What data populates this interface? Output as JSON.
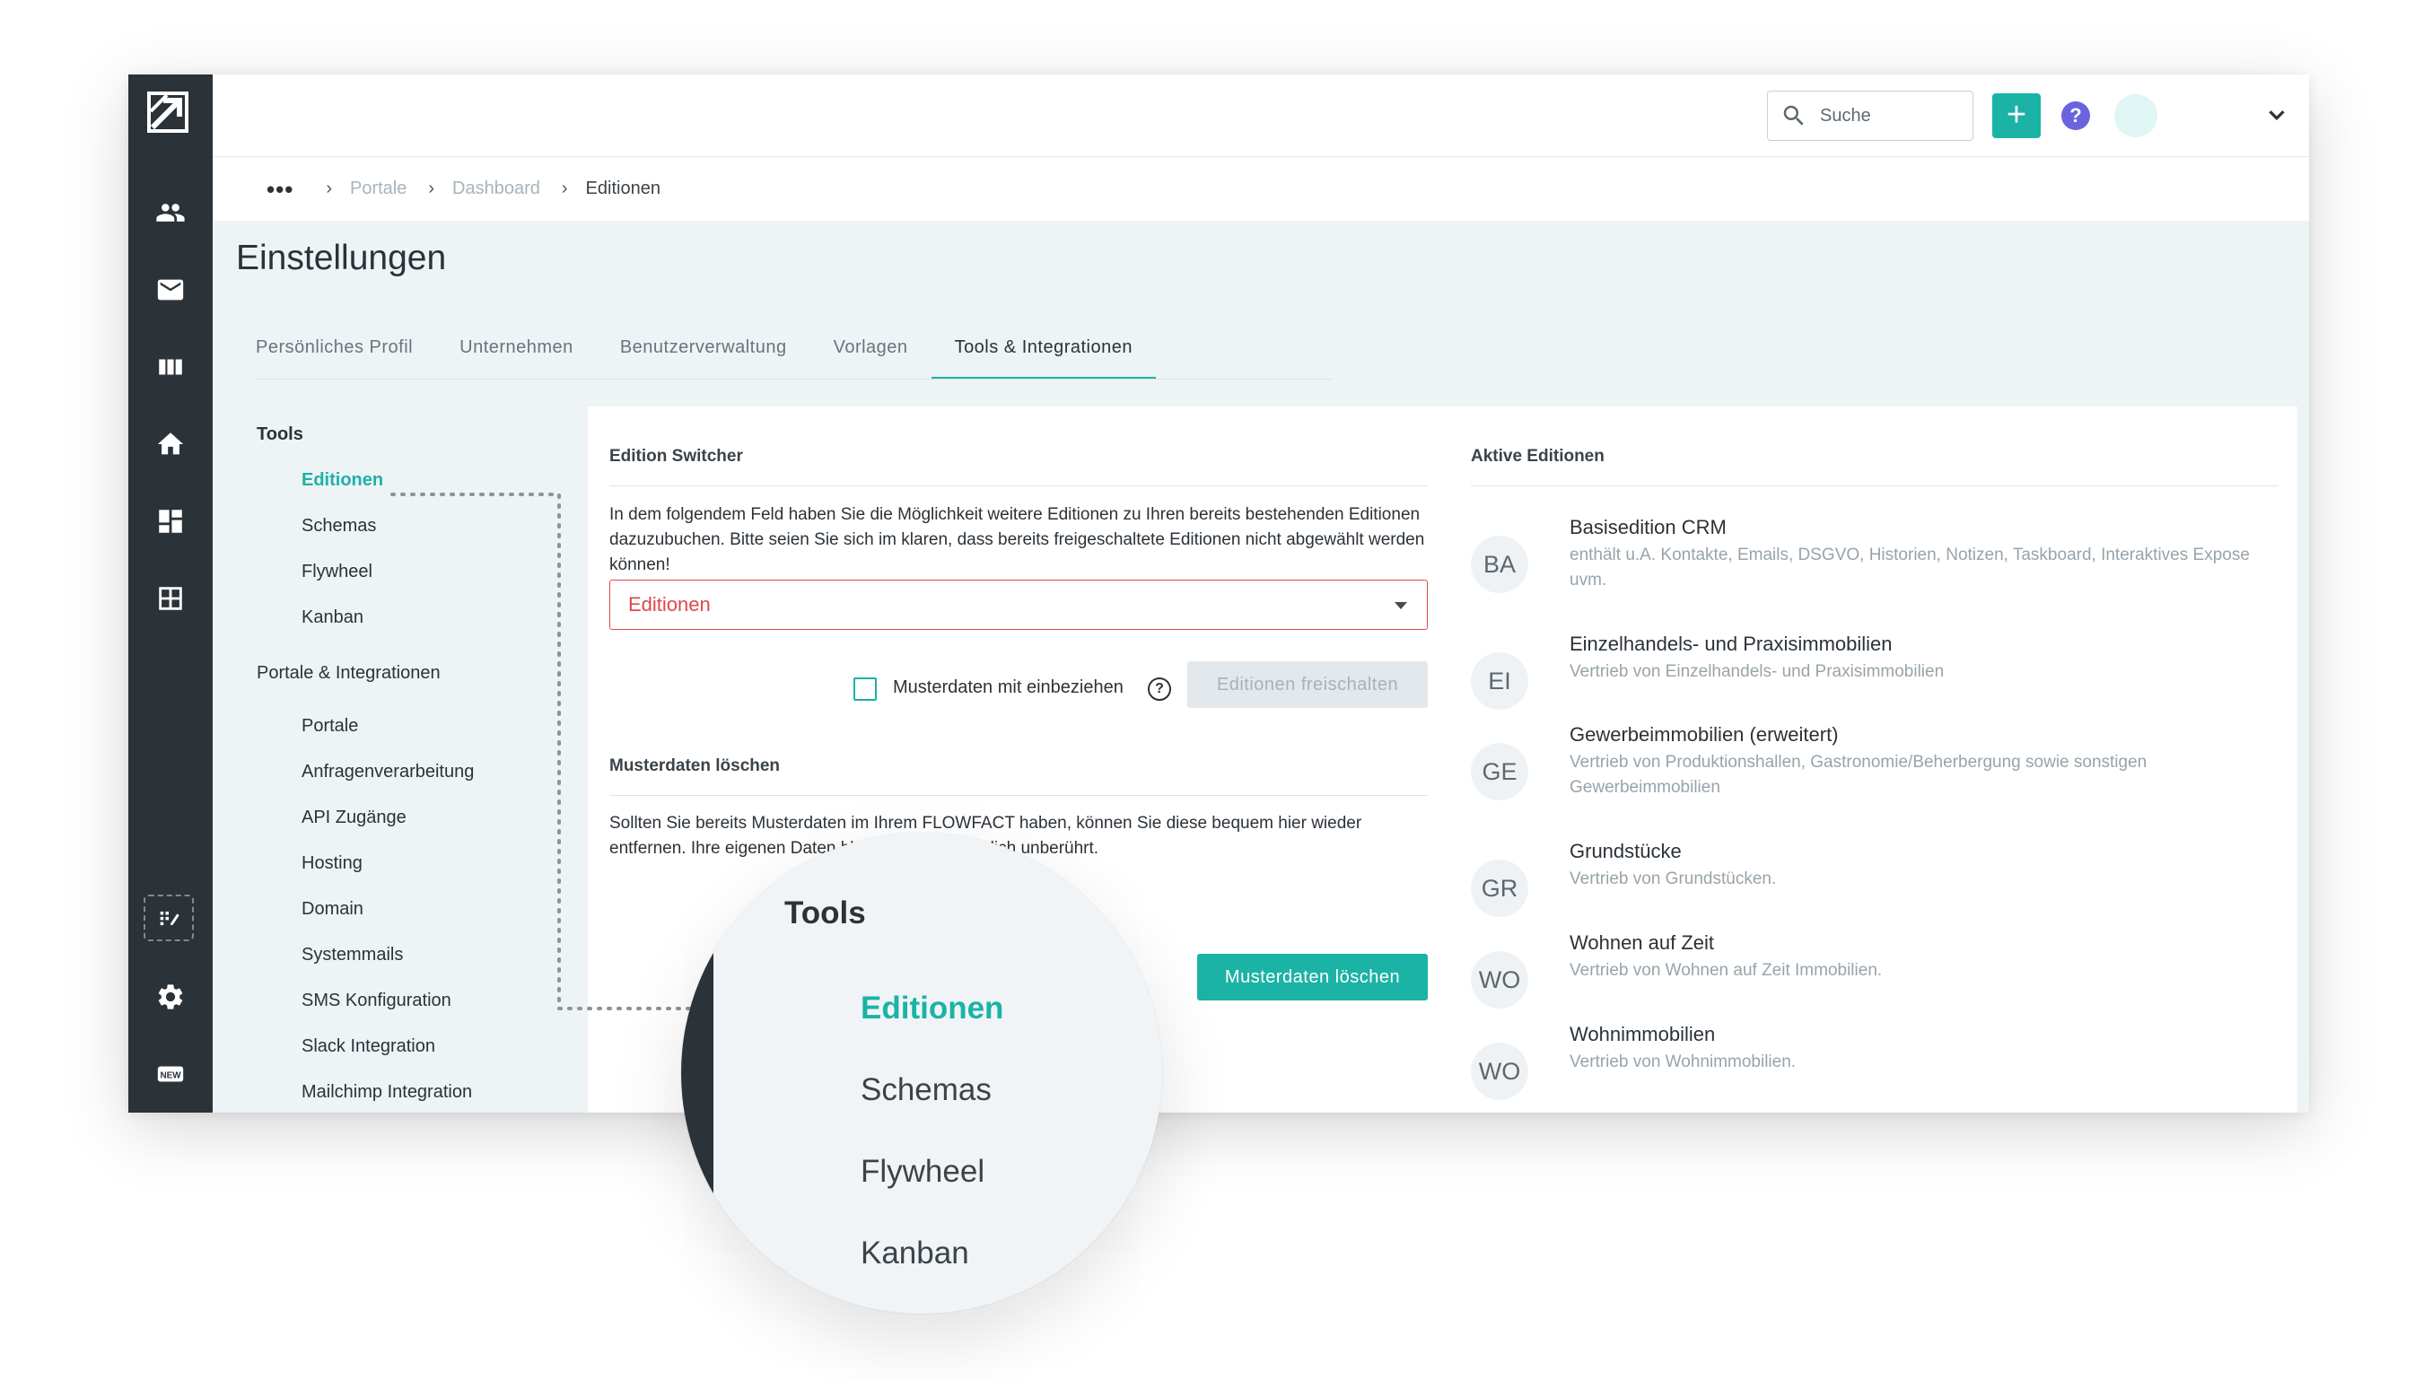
{
  "topbar": {
    "search_placeholder": "Suche",
    "add_label": "+",
    "help_label": "?"
  },
  "breadcrumb": {
    "overflow": "•••",
    "items": [
      "Portale",
      "Dashboard",
      "Editionen"
    ]
  },
  "page": {
    "title": "Einstellungen",
    "tabs": [
      "Persönliches Profil",
      "Unternehmen",
      "Benutzerverwaltung",
      "Vorlagen",
      "Tools & Integrationen"
    ],
    "active_tab": "Tools & Integrationen"
  },
  "tools_menu": {
    "tools_heading": "Tools",
    "tools_items": [
      "Editionen",
      "Schemas",
      "Flywheel",
      "Kanban"
    ],
    "portals_heading": "Portale & Integrationen",
    "portals_items": [
      "Portale",
      "Anfragenverarbeitung",
      "API Zugänge",
      "Hosting",
      "Domain",
      "Systemmails",
      "SMS Konfiguration",
      "Slack Integration",
      "Mailchimp Integration"
    ]
  },
  "edition_switcher": {
    "title": "Edition Switcher",
    "description": "In dem folgendem Feld haben Sie die Möglichkeit weitere Editionen zu Ihren bereits bestehenden Editionen dazuzubuchen. Bitte seien Sie sich im klaren, dass bereits freigeschaltete Editionen nicht abgewählt werden können!",
    "select_placeholder": "Editionen",
    "checkbox_label": "Musterdaten mit einbeziehen",
    "unlock_button": "Editionen freischalten"
  },
  "sample_data": {
    "title": "Musterdaten löschen",
    "description": "Sollten Sie bereits Musterdaten im Ihrem FLOWFACT haben, können Sie diese bequem hier wieder entfernen. Ihre eigenen Daten bleiben davon natürlich unberührt.",
    "delete_button": "Musterdaten löschen"
  },
  "active_editions": {
    "title": "Aktive Editionen",
    "items": [
      {
        "badge": "BA",
        "name": "Basisedition CRM",
        "description": "enthält u.A. Kontakte, Emails, DSGVO, Historien, Notizen, Taskboard, Interaktives Expose uvm."
      },
      {
        "badge": "EI",
        "name": "Einzelhandels- und Praxisimmobilien",
        "description": "Vertrieb von Einzelhandels- und Praxisimmobilien"
      },
      {
        "badge": "GE",
        "name": "Gewerbeimmobilien (erweitert)",
        "description": "Vertrieb von Produktionshallen, Gastronomie/Beherbergung sowie sonstigen Gewerbeimmobilien"
      },
      {
        "badge": "GR",
        "name": "Grundstücke",
        "description": "Vertrieb von Grundstücken."
      },
      {
        "badge": "WO",
        "name": "Wohnen auf Zeit",
        "description": "Vertrieb von Wohnen auf Zeit Immobilien."
      },
      {
        "badge": "WO",
        "name": "Wohnimmobilien",
        "description": "Vertrieb von Wohnimmobilien."
      }
    ]
  },
  "magnifier": {
    "title": "Tools",
    "items": [
      "Editionen",
      "Schemas",
      "Flywheel",
      "Kanban"
    ]
  },
  "icons": {
    "sidebar": [
      "logo-icon",
      "contacts-icon",
      "mail-icon",
      "columns-icon",
      "home-icon",
      "dashboard-icon",
      "grid-icon",
      "flywheel-icon",
      "settings-icon",
      "new-icon"
    ]
  },
  "colors": {
    "accent": "#1bb3a5",
    "sidebar": "#2b3238",
    "error": "#e0474c",
    "help": "#6b63de"
  }
}
